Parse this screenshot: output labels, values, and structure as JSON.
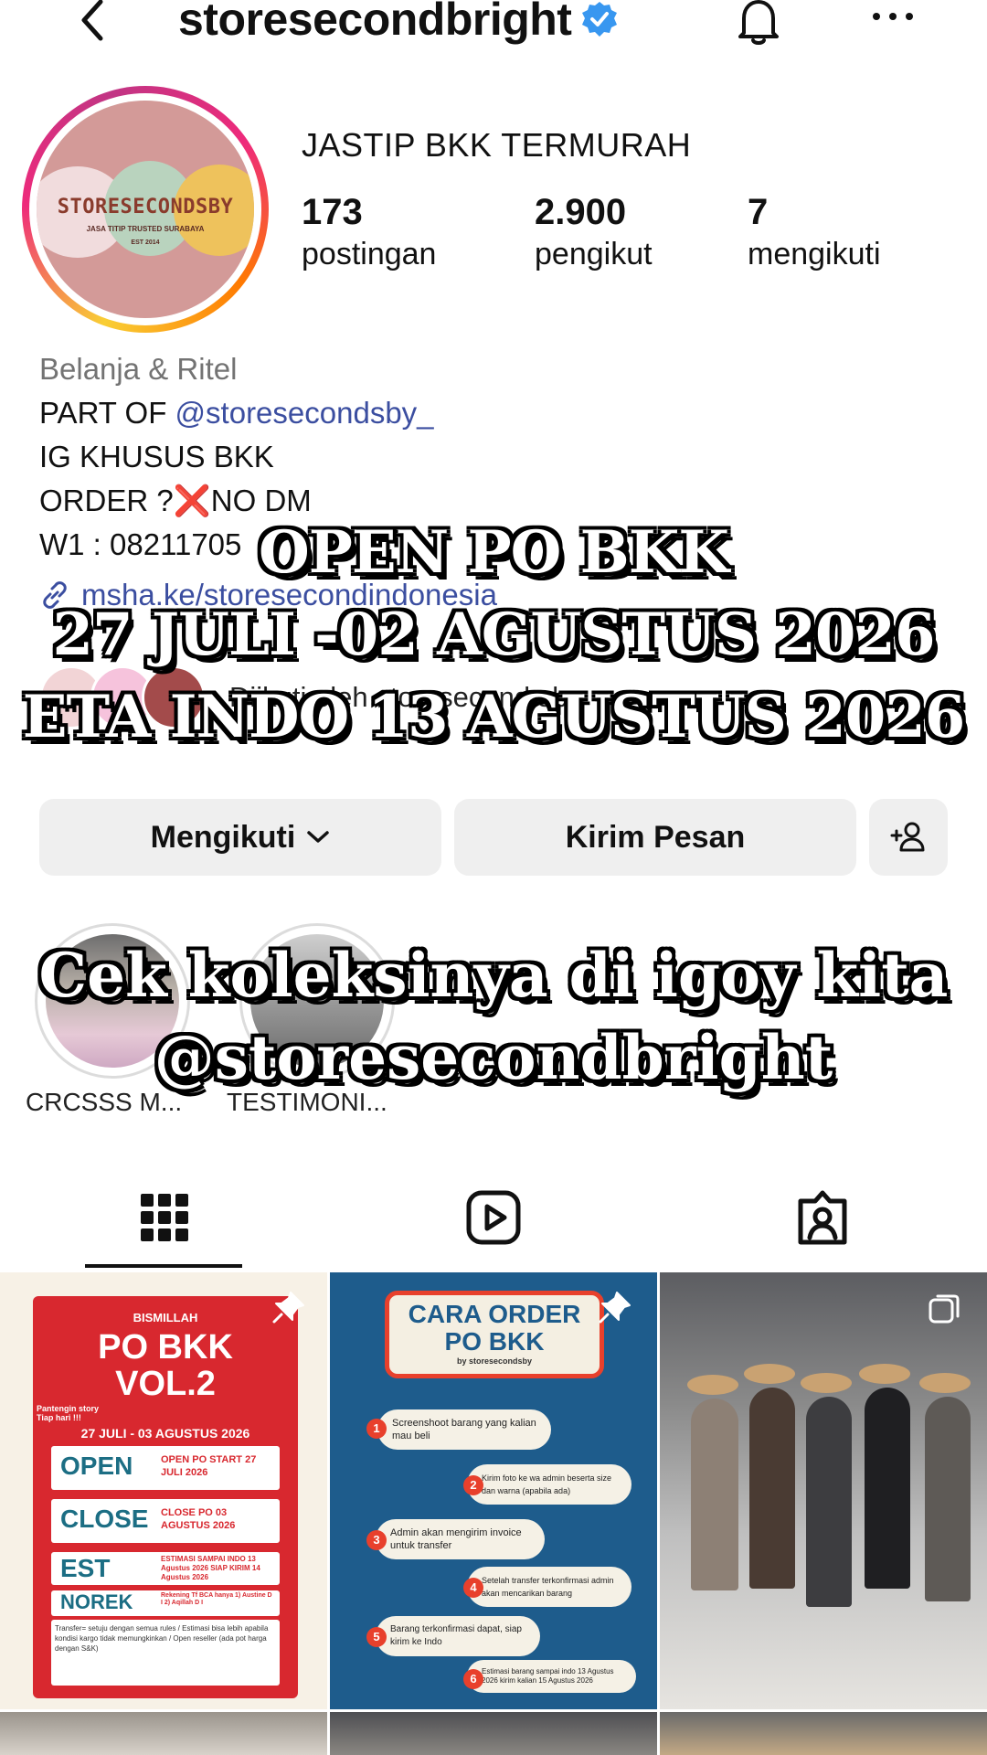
{
  "header": {
    "username": "storesecondbright",
    "back_icon": "chevron-left-icon",
    "notification_icon": "bell-icon",
    "more_icon": "more-horizontal-icon"
  },
  "profile": {
    "avatar_text": "STORESECONDSBY",
    "avatar_tagline": "JASA TITIP TRUSTED SURABAYA",
    "avatar_est": "EST 2014",
    "display_name": "JASTIP BKK TERMURAH",
    "stats": [
      {
        "count": "173",
        "label": "postingan"
      },
      {
        "count": "2.900",
        "label": "pengikut"
      },
      {
        "count": "7",
        "label": "mengikuti"
      }
    ]
  },
  "bio": {
    "category": "Belanja & Ritel",
    "line1_prefix": "PART OF ",
    "line1_mention": "@storesecondsby_",
    "line2": "IG KHUSUS BKK",
    "line3_prefix": "ORDER ?",
    "line3_x": "❌",
    "line3_suffix": "NO DM",
    "line4": "W1 : 08211705",
    "link": "msha.ke/storesecondindonesia",
    "followed_by": "Diikuti oleh storesecond.sby"
  },
  "buttons": {
    "following": "Mengikuti",
    "message": "Kirim Pesan"
  },
  "overlay": {
    "line1": "OPEN PO BKK",
    "line2": "27 JULI -02  AGUSTUS 2026",
    "line3": "ETA INDO 13 AGUSTUS 2026",
    "line4": "Cek koleksinya di igoy kita",
    "line5": "@storesecondbright"
  },
  "highlights": [
    {
      "label": "CRCSSS M..."
    },
    {
      "label": "TESTIMONI..."
    }
  ],
  "tabs": [
    {
      "name": "grid",
      "icon": "grid-icon",
      "active": true
    },
    {
      "name": "reels",
      "icon": "reels-icon",
      "active": false
    },
    {
      "name": "tagged",
      "icon": "tagged-icon",
      "active": false
    }
  ],
  "posts": {
    "post1": {
      "top": "BISMILLAH",
      "title1": "PO BKK",
      "title2": "VOL.2",
      "note": "Pantengin story Tiap hari !!!",
      "dates": "27 JULI - 03 AGUSTUS 2026",
      "rows": [
        {
          "big": "OPEN",
          "sub": "OPEN PO START 27 JULI 2026"
        },
        {
          "big": "CLOSE",
          "sub": "CLOSE PO 03 AGUSTUS 2026"
        },
        {
          "big": "EST",
          "sub": "ESTIMASI SAMPAI INDO 13 Agustus 2026 SIAP KIRIM 14 Agustus 2026"
        },
        {
          "big": "NOREK",
          "sub": "Rekening Tf BCA hanya 1) Austine D I 2) Aqillah D I"
        }
      ],
      "notes": "Transfer= setuju dengan semua rules / Estimasi bisa lebih apabila kondisi kargo tidak memungkinkan / Open reseller (ada pot harga dengan S&K)"
    },
    "post2": {
      "title1": "CARA ORDER",
      "title2": "PO BKK",
      "by": "by storesecondsby",
      "steps": [
        "Screenshoot barang yang kalian mau beli",
        "Kirim foto ke wa admin beserta size dan warna (apabila ada)",
        "Admin akan mengirim invoice untuk transfer",
        "Setelah transfer terkonfirmasi admin akan mencarikan barang",
        "Barang terkonfirmasi dapat, siap kirim ke Indo",
        "Estimasi barang sampai indo 13 Agustus 2026 kirim kalian 15 Agustus 2026"
      ]
    }
  },
  "colors": {
    "link": "#3b4ea0",
    "button_bg": "#efefef",
    "verified": "#3897f0"
  }
}
